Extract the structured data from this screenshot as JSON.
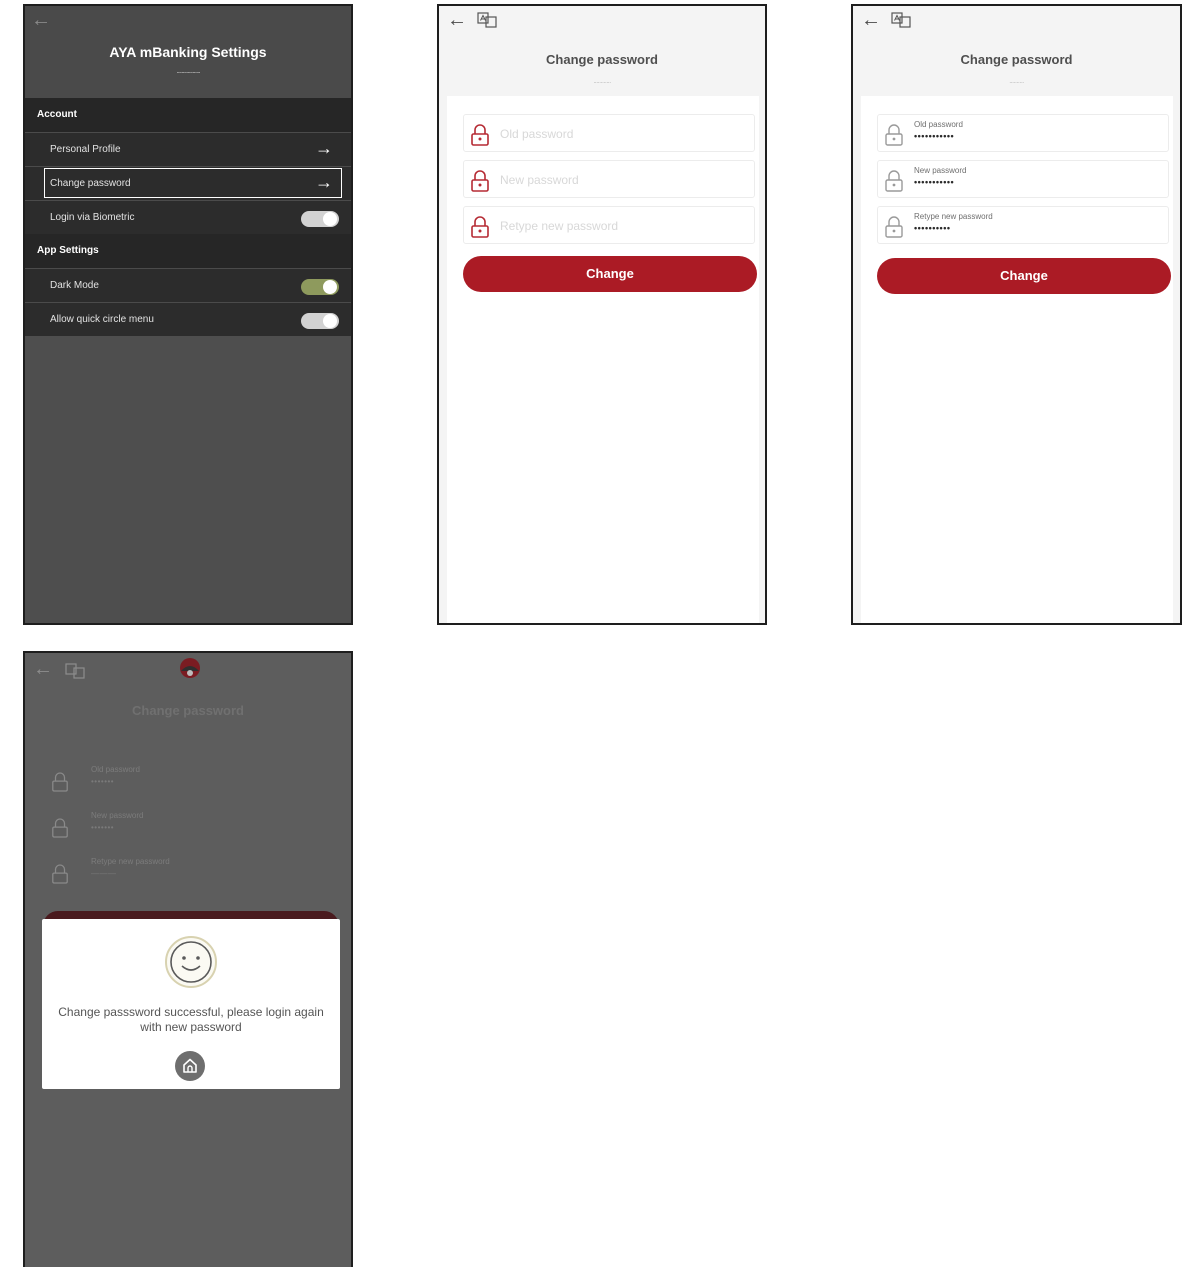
{
  "settings": {
    "title": "AYA mBanking Settings",
    "title_underline": "...................",
    "sections": [
      {
        "label": "Account",
        "items": [
          {
            "label": "Personal Profile",
            "control": "arrow"
          },
          {
            "label": "Change password",
            "control": "arrow",
            "selected": true
          },
          {
            "label": "Login via Biometric",
            "control": "toggle",
            "on": false
          }
        ]
      },
      {
        "label": "App Settings",
        "items": [
          {
            "label": "Dark Mode",
            "control": "toggle",
            "on": true
          },
          {
            "label": "Allow quick circle menu",
            "control": "toggle",
            "on": false
          }
        ]
      }
    ]
  },
  "change_password_empty": {
    "title": "Change password",
    "title_underline": "............",
    "fields": [
      {
        "placeholder": "Old password"
      },
      {
        "placeholder": "New password"
      },
      {
        "placeholder": "Retype new password"
      }
    ],
    "button_label": "Change"
  },
  "change_password_filled": {
    "title": "Change password",
    "title_underline": "..........",
    "fields": [
      {
        "label": "Old password",
        "value": "•••••••••••"
      },
      {
        "label": "New password",
        "value": "•••••••••••"
      },
      {
        "label": "Retype new password",
        "value": "••••••••••"
      }
    ],
    "button_label": "Change"
  },
  "success": {
    "title": "Change password",
    "fields": [
      {
        "label": "Old password",
        "value": "•••••••"
      },
      {
        "label": "New password",
        "value": "•••••••"
      },
      {
        "label": "Retype new password",
        "value": "———"
      }
    ],
    "message": "Change passsword successful, please login again with new password"
  },
  "icons": {
    "back": "arrow-left-icon",
    "forward": "arrow-right-icon",
    "language": "language-translate-icon",
    "lock": "lock-icon",
    "smiley": "smiley-face-icon",
    "home": "home-icon",
    "logo": "aya-bank-logo-icon"
  },
  "colors": {
    "brand_red": "#ab1b25",
    "toggle_on": "#8e9a5d",
    "dark_row": "#2c2c2c",
    "section_bg": "#262626"
  }
}
